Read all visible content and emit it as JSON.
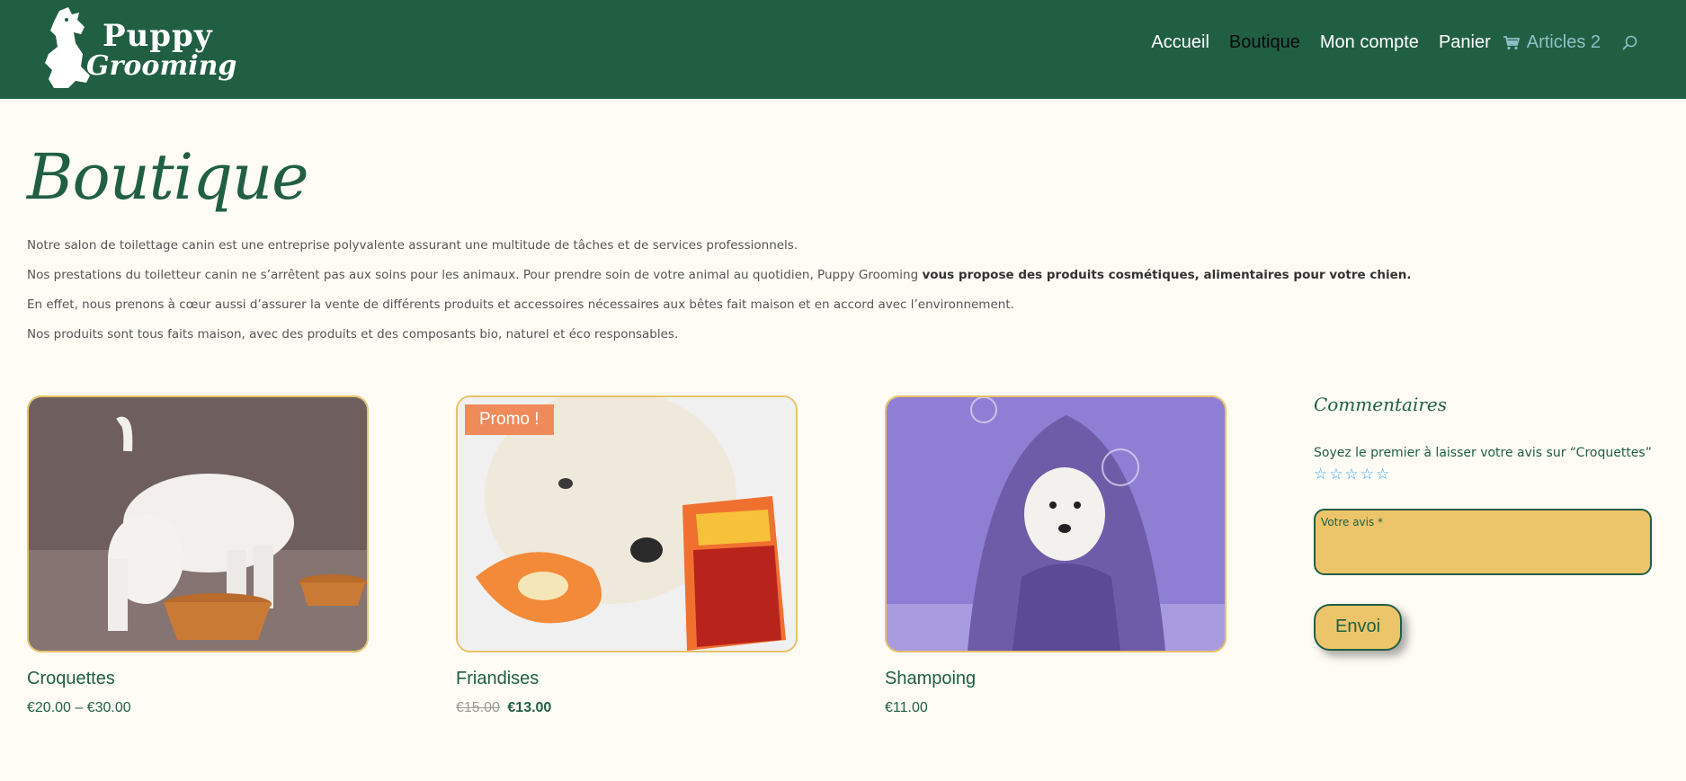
{
  "brand": {
    "line1": "Puppy",
    "line2": "Grooming"
  },
  "nav": {
    "items": [
      {
        "label": "Accueil"
      },
      {
        "label": "Boutique"
      },
      {
        "label": "Mon compte"
      },
      {
        "label": "Panier"
      }
    ],
    "cart_label": "Articles 2"
  },
  "page": {
    "title": "Boutique",
    "intro": {
      "p1": "Notre salon de toilettage canin est une entreprise polyvalente assurant une multitude de tâches et de services professionnels.",
      "p2_start": "Nos prestations du toiletteur canin ne s’arrêtent pas aux soins pour les animaux. Pour prendre soin de votre animal au quotidien, Puppy Grooming ",
      "p2_bold": "vous propose des produits cosmétiques, alimentaires pour votre chien.",
      "p3": "En effet, nous prenons à cœur aussi d’assurer la vente de différents produits et accessoires nécessaires aux bêtes fait maison et en accord avec l’environnement.",
      "p4": "Nos produits sont tous faits maison, avec des produits et des composants bio, naturel et éco responsables."
    }
  },
  "products": [
    {
      "name": "Croquettes",
      "price": "€20.00 – €30.00"
    },
    {
      "name": "Friandises",
      "badge": "Promo !",
      "old_price": "€15.00",
      "new_price": "€13.00"
    },
    {
      "name": "Shampoing",
      "price": "€11.00"
    }
  ],
  "sidebar": {
    "title": "Commentaires",
    "text": "Soyez le premier à laisser votre avis sur “Croquettes”",
    "review_label": "Votre avis *",
    "submit": "Envoi"
  },
  "colors": {
    "header_bg": "#215f43",
    "accent_green": "#215f43",
    "gold": "#ecc56a",
    "promo": "#ef8a5a",
    "star": "#2ea3f2"
  }
}
